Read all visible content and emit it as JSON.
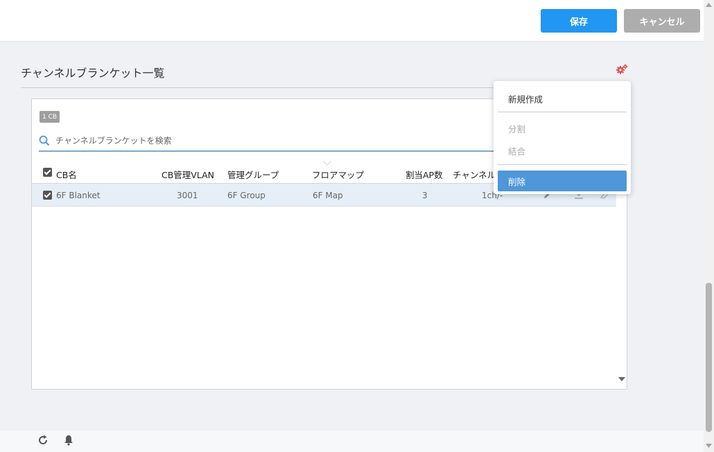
{
  "header": {
    "save_label": "保存",
    "cancel_label": "キャンセル"
  },
  "section": {
    "title": "チャンネルブランケット一覧"
  },
  "panel": {
    "count_badge": "1 CB",
    "search": {
      "placeholder": "チャンネルブランケットを検索",
      "value": ""
    },
    "columns": [
      "CB名",
      "CB管理VLAN",
      "管理グループ",
      "フロアマップ",
      "割当AP数",
      "チャンネル"
    ],
    "rows": [
      {
        "checked": true,
        "name": "6F Blanket",
        "vlan": "3001",
        "group": "6F Group",
        "map": "6F Map",
        "ap_count": "3",
        "channel": "1ch/-"
      }
    ]
  },
  "menu": {
    "items": [
      {
        "label": "新規作成",
        "enabled": true
      },
      {
        "label": "分割",
        "enabled": false
      },
      {
        "label": "結合",
        "enabled": false
      },
      {
        "label": "削除",
        "enabled": true,
        "highlighted": true
      }
    ]
  },
  "icons": {
    "settings": "gear-icon",
    "search": "search-icon",
    "edit": "pencil-icon",
    "download": "download-icon",
    "clear": "eraser-icon",
    "refresh": "refresh-icon",
    "notifications": "bell-icon"
  },
  "colors": {
    "primary": "#2196f3",
    "secondary": "#adadad",
    "menu_highlight": "#4f97d9",
    "row_selected": "#e6eff8",
    "gear": "#d9534f"
  }
}
